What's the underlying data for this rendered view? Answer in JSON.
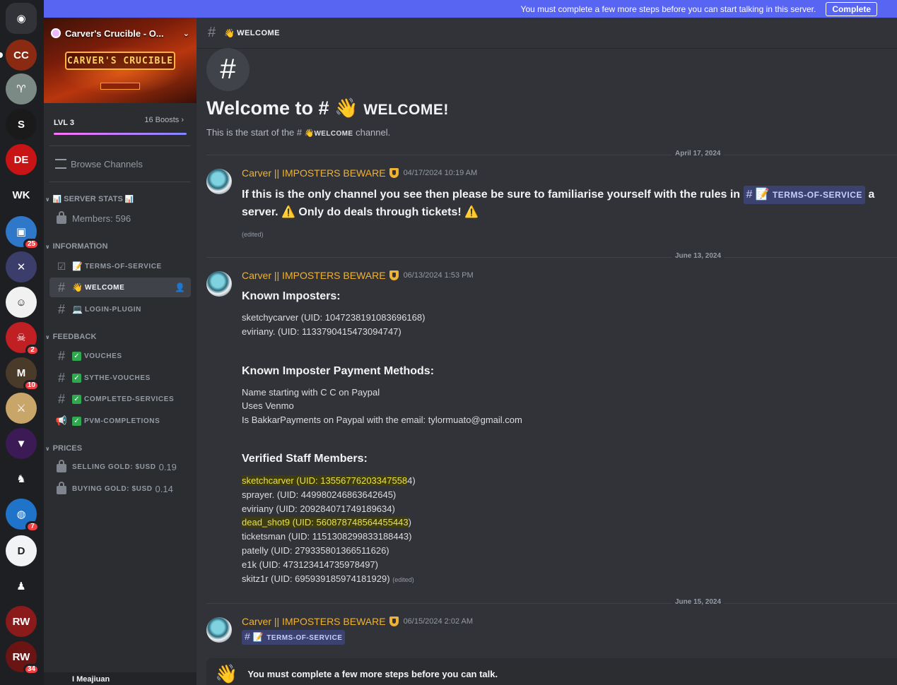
{
  "banner": {
    "message": "You must complete a few more steps before you can start talking in this server.",
    "complete_label": "Complete"
  },
  "server": {
    "name": "Carver's Crucible - O...",
    "banner_text": "CARVER'S CRUCIBLE",
    "level": "LVL 3",
    "boosts": "16 Boosts",
    "browse_label": "Browse Channels"
  },
  "rail": {
    "icons": [
      {
        "name": "discord-home-icon",
        "glyph": "◉",
        "color": "#313338",
        "badge": ""
      },
      {
        "name": "server-carvers-crucible",
        "glyph": "CC",
        "color": "#8a2a12",
        "badge": ""
      },
      {
        "name": "server-green-ribbon",
        "glyph": "♈",
        "color": "#7c8a86",
        "badge": ""
      },
      {
        "name": "server-s-gold",
        "glyph": "S",
        "color": "#1a1a1a",
        "badge": ""
      },
      {
        "name": "server-de",
        "glyph": "DE",
        "color": "#c81414",
        "badge": ""
      },
      {
        "name": "server-wk",
        "glyph": "WK",
        "color": "#1e1f22",
        "badge": ""
      },
      {
        "name": "server-dice",
        "glyph": "▣",
        "color": "#2f77c9",
        "badge": "25"
      },
      {
        "name": "server-x",
        "glyph": "✕",
        "color": "#3b3d6a",
        "badge": ""
      },
      {
        "name": "server-face",
        "glyph": "☺",
        "color": "#f1f1f1",
        "badge": ""
      },
      {
        "name": "server-red-skull",
        "glyph": "☠",
        "color": "#c01f24",
        "badge": "2"
      },
      {
        "name": "server-maxedgp",
        "glyph": "M",
        "color": "#4a3a2a",
        "badge": "10"
      },
      {
        "name": "server-sword-shield",
        "glyph": "⚔",
        "color": "#c8a66a",
        "badge": ""
      },
      {
        "name": "server-purple-hood",
        "glyph": "▼",
        "color": "#3b1a55",
        "badge": ""
      },
      {
        "name": "server-camel",
        "glyph": "♞",
        "color": "#1e1f22",
        "badge": ""
      },
      {
        "name": "server-blue-orb",
        "glyph": "◍",
        "color": "#1f74c9",
        "badge": "7"
      },
      {
        "name": "server-d-logo",
        "glyph": "D",
        "color": "#f2f3f5",
        "badge": ""
      },
      {
        "name": "server-pixel-man",
        "glyph": "♟",
        "color": "#1e1f22",
        "badge": ""
      },
      {
        "name": "server-rw",
        "glyph": "RW",
        "color": "#8b1a1a",
        "badge": ""
      },
      {
        "name": "server-rw-2",
        "glyph": "RW",
        "color": "#6a1414",
        "badge": "34"
      }
    ]
  },
  "categories": {
    "server_stats": "SERVER STATS",
    "information": "INFORMATION",
    "feedback": "FEEDBACK",
    "prices": "PRICES"
  },
  "channels": {
    "members": "Members: 596",
    "terms": "TERMS-OF-SERVICE",
    "welcome": "WELCOME",
    "login_plugin": "LOGIN-PLUGIN",
    "vouches": "VOUCHES",
    "sythe_vouches": "SYTHE-VOUCHES",
    "completed_services": "COMPLETED-SERVICES",
    "pvm_completions": "PVM-COMPLETIONS",
    "selling_gold_label": "SELLING GOLD: $USD",
    "selling_gold_value": "0.19",
    "buying_gold_label": "BUYING GOLD: $USD",
    "buying_gold_value": "0.14"
  },
  "user": {
    "name": "I Meajiuan"
  },
  "header": {
    "channel_name": "WELCOME"
  },
  "welcome": {
    "title_prefix": "Welcome to #",
    "title_channel": "WELCOME!",
    "sub_prefix": "This is the start of the #",
    "sub_channel": "WELCOME",
    "sub_suffix": " channel."
  },
  "dates": {
    "d1": "April 17, 2024",
    "d2": "June 13, 2024",
    "d3": "June 15, 2024"
  },
  "messages": {
    "author": "Carver || IMPOSTERS BEWARE",
    "m1": {
      "time": "04/17/2024 10:19 AM",
      "line1_a": "If this is the only channel you see then please be sure to familiarise yourself with the rules in ",
      "line1_mention": "TERMS-OF-SERVICE",
      "line1_b": " a",
      "line2_a": "server. ",
      "line2_b": " Only do deals through tickets! ",
      "edited": "(edited)"
    },
    "m2": {
      "time": "06/13/2024 1:53 PM",
      "known_imposters_title": "Known Imposters:",
      "imposters": [
        "sketchycarver (UID: 1047238191083696168)",
        "eviriany. (UID: 1133790415473094747)"
      ],
      "payment_title": "Known Imposter Payment Methods:",
      "payments": [
        "Name starting with C C on Paypal",
        "Uses Venmo",
        "Is BakkarPayments on Paypal with the email: tylormuato@gmail.com"
      ],
      "staff_title": "Verified Staff Members:",
      "staff_1_hl": "sketchcarver (UID: 13556776203347558",
      "staff_1_rest": "4)",
      "staff_2": "sprayer. (UID: 449980246863642645)",
      "staff_3": "eviriany (UID: 209284071749189634)",
      "staff_4_hl": "dead_shot9 (UID: 560878748564455443",
      "staff_4_rest": ")",
      "staff_5": "ticketsman (UID: 1151308299833188443)",
      "staff_6": "patelly (UID: 279335801366511626)",
      "staff_7": "e1k (UID: 473123414735978497)",
      "staff_8": "skitz1r (UID: 695939185974181929)",
      "edited": "(edited)"
    },
    "m3": {
      "time": "06/15/2024 2:02 AM",
      "mention": "TERMS-OF-SERVICE"
    }
  },
  "notice": {
    "text": "You must complete a few more steps before you can talk."
  }
}
